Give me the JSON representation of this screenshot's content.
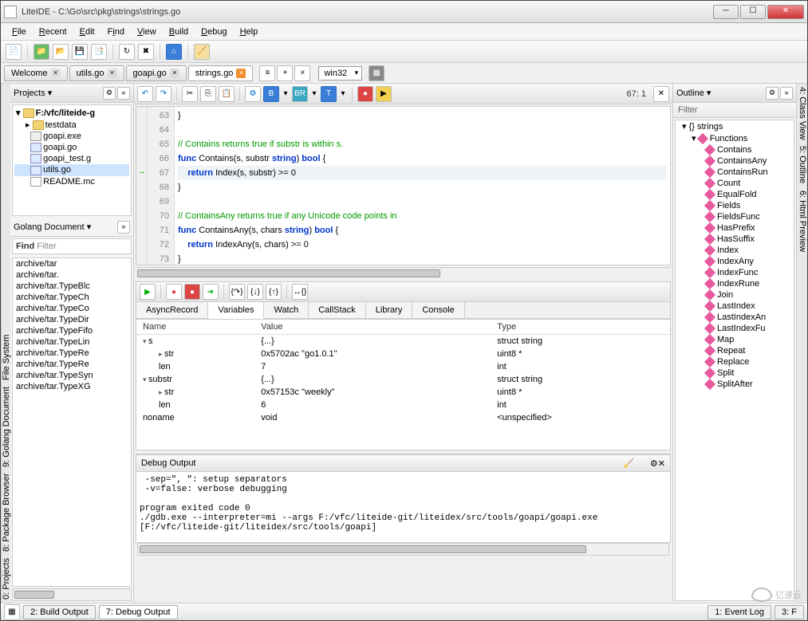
{
  "window": {
    "title": "LiteIDE - C:\\Go\\src\\pkg\\strings\\strings.go"
  },
  "menus": [
    "File",
    "Recent",
    "Edit",
    "Find",
    "View",
    "Build",
    "Debug",
    "Help"
  ],
  "tabs": [
    {
      "label": "Welcome",
      "closable": true
    },
    {
      "label": "utils.go",
      "closable": true
    },
    {
      "label": "goapi.go",
      "closable": true
    },
    {
      "label": "strings.go",
      "closable": true,
      "active": true
    }
  ],
  "target_combo": "win32",
  "editor": {
    "cursor": "67:  1",
    "lines": [
      {
        "n": 63,
        "t": "}"
      },
      {
        "n": 64,
        "t": ""
      },
      {
        "n": 65,
        "t": "// Contains returns true if substr is within s.",
        "cls": "cm"
      },
      {
        "n": 66,
        "t": "func Contains(s, substr string) bool {",
        "hl": false
      },
      {
        "n": 67,
        "t": "    return Index(s, substr) >= 0",
        "hl": true,
        "mark": "→"
      },
      {
        "n": 68,
        "t": "}"
      },
      {
        "n": 69,
        "t": ""
      },
      {
        "n": 70,
        "t": "// ContainsAny returns true if any Unicode code points in",
        "cls": "cm"
      },
      {
        "n": 71,
        "t": "func ContainsAny(s, chars string) bool {"
      },
      {
        "n": 72,
        "t": "    return IndexAny(s, chars) >= 0"
      },
      {
        "n": 73,
        "t": "}"
      }
    ]
  },
  "projects": {
    "title": "Projects",
    "root": "F:/vfc/liteide-g",
    "items": [
      {
        "label": "testdata",
        "type": "folder"
      },
      {
        "label": "goapi.exe",
        "type": "exe"
      },
      {
        "label": "goapi.go",
        "type": "go"
      },
      {
        "label": "goapi_test.g",
        "type": "go"
      },
      {
        "label": "utils.go",
        "type": "go",
        "sel": true
      },
      {
        "label": "README.mc",
        "type": "file"
      }
    ]
  },
  "golang_doc": {
    "title": "Golang Document",
    "filter_label": "Find",
    "filter_hint": "Filter",
    "packages": [
      "archive/tar",
      "archive/tar.",
      "archive/tar.TypeBlc",
      "archive/tar.TypeCh",
      "archive/tar.TypeCo",
      "archive/tar.TypeDir",
      "archive/tar.TypeFifo",
      "archive/tar.TypeLin",
      "archive/tar.TypeRe",
      "archive/tar.TypeRe",
      "archive/tar.TypeSyn",
      "archive/tar.TypeXG"
    ]
  },
  "left_tabs": [
    "0: Projects",
    "8: Package Browser",
    "9: Golang Document",
    "File System"
  ],
  "right_tabs": [
    "4: Class View",
    "5: Outline",
    "6: Html Preview"
  ],
  "debug_tabs": [
    "AsyncRecord",
    "Variables",
    "Watch",
    "CallStack",
    "Library",
    "Console"
  ],
  "debug_active_tab": "Variables",
  "variables": {
    "cols": [
      "Name",
      "Value",
      "Type"
    ],
    "rows": [
      {
        "ind": 0,
        "tri": "open",
        "name": "s",
        "value": "{...}",
        "type": "struct string"
      },
      {
        "ind": 1,
        "tri": "closed",
        "name": "str",
        "value": "0x5702ac \"go1.0.1\"",
        "type": "uint8 *"
      },
      {
        "ind": 1,
        "name": "len",
        "value": "7",
        "type": "int"
      },
      {
        "ind": 0,
        "tri": "open",
        "name": "substr",
        "value": "{...}",
        "type": "struct string"
      },
      {
        "ind": 1,
        "tri": "closed",
        "name": "str",
        "value": "0x57153c \"weekly\"",
        "type": "uint8 *"
      },
      {
        "ind": 1,
        "name": "len",
        "value": "6",
        "type": "int"
      },
      {
        "ind": 0,
        "name": "noname",
        "value": "void",
        "type": "<unspecified>"
      }
    ]
  },
  "outline": {
    "title": "Outline",
    "filter": "Filter",
    "root": "{} strings",
    "group": "Functions",
    "funcs": [
      "Contains",
      "ContainsAny",
      "ContainsRun",
      "Count",
      "EqualFold",
      "Fields",
      "FieldsFunc",
      "HasPrefix",
      "HasSuffix",
      "Index",
      "IndexAny",
      "IndexFunc",
      "IndexRune",
      "Join",
      "LastIndex",
      "LastIndexAn",
      "LastIndexFu",
      "Map",
      "Repeat",
      "Replace",
      "Split",
      "SplitAfter"
    ]
  },
  "debug_output": {
    "title": "Debug Output",
    "text": " -sep=\", \": setup separators\n -v=false: verbose debugging\n\nprogram exited code 0\n./gdb.exe --interpreter=mi --args F:/vfc/liteide-git/liteidex/src/tools/goapi/goapi.exe [F:/vfc/liteide-git/liteidex/src/tools/goapi]"
  },
  "status": {
    "items": [
      "2: Build Output",
      "7: Debug Output"
    ],
    "right": [
      "1: Event Log",
      "3: F"
    ]
  },
  "watermark": "亿速云"
}
